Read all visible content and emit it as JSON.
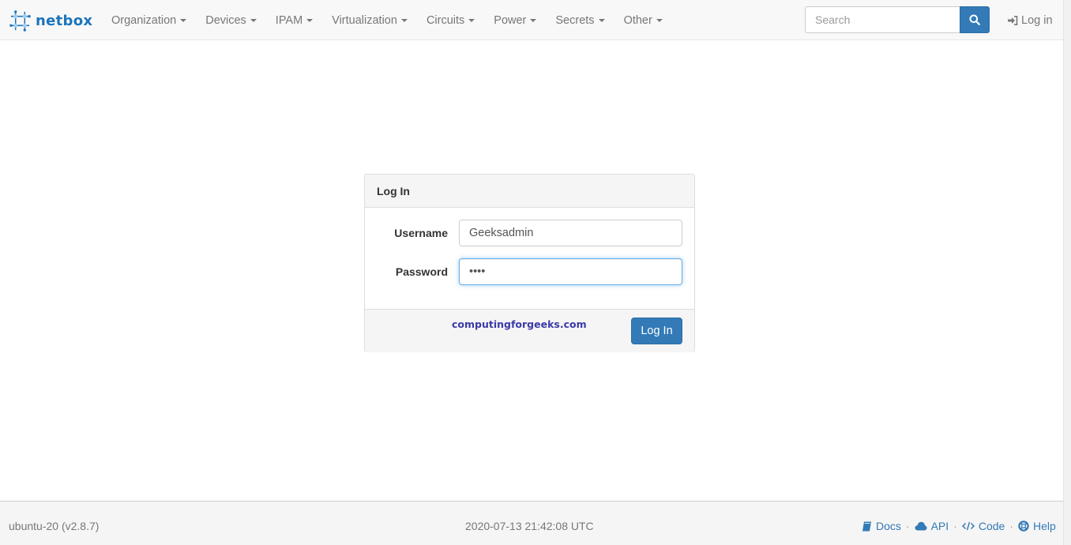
{
  "brand": {
    "name": "netbox",
    "icon": "netbox-logo-icon"
  },
  "nav": {
    "items": [
      {
        "label": "Organization"
      },
      {
        "label": "Devices"
      },
      {
        "label": "IPAM"
      },
      {
        "label": "Virtualization"
      },
      {
        "label": "Circuits"
      },
      {
        "label": "Power"
      },
      {
        "label": "Secrets"
      },
      {
        "label": "Other"
      }
    ],
    "search_placeholder": "Search",
    "login_label": "Log in"
  },
  "login_panel": {
    "title": "Log In",
    "username_label": "Username",
    "username_value": "Geeksadmin",
    "password_label": "Password",
    "password_value": "test",
    "watermark": "computingforgeeks.com",
    "submit_label": "Log In"
  },
  "footer": {
    "host_version": "ubuntu-20 (v2.8.7)",
    "timestamp": "2020-07-13 21:42:08 UTC",
    "links": [
      {
        "label": "Docs",
        "icon": "book-icon"
      },
      {
        "label": "API",
        "icon": "cloud-icon"
      },
      {
        "label": "Code",
        "icon": "code-icon"
      },
      {
        "label": "Help",
        "icon": "lifebuoy-icon"
      }
    ],
    "separator": "·"
  },
  "colors": {
    "primary": "#337ab7",
    "brand": "#1b75bb",
    "navbar_bg": "#f8f8f8",
    "nav_text": "#777777",
    "focus_border": "#66afe9",
    "watermark": "#3a3aa8"
  }
}
